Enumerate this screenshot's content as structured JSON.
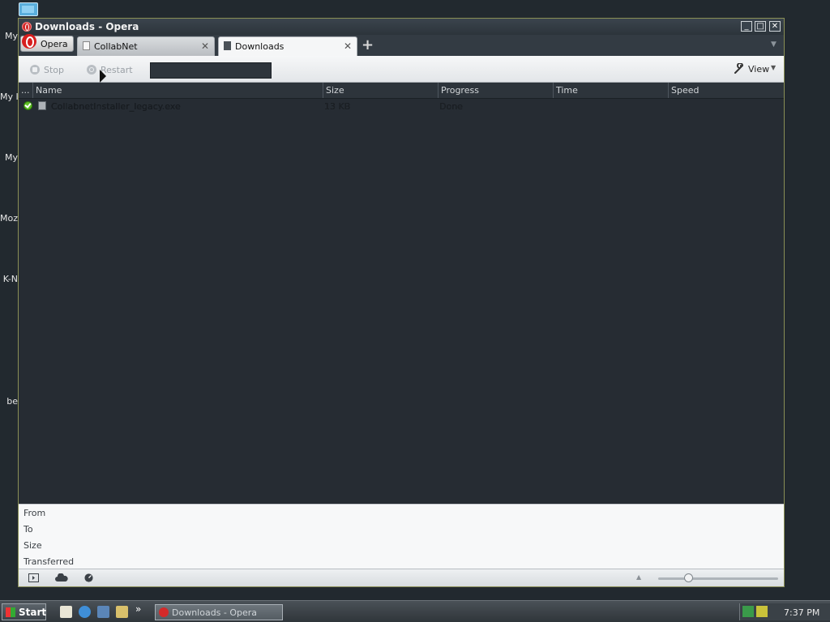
{
  "desktop": {
    "icon_labels": [
      "My",
      "My I",
      "My",
      "Moz",
      "K-N",
      "be"
    ]
  },
  "window": {
    "title": "Downloads - Opera",
    "controls": {
      "minimize": "_",
      "maximize": "□",
      "close": "✕"
    }
  },
  "tabs": {
    "opera_menu": "Opera",
    "items": [
      {
        "label": "CollabNet",
        "active": false,
        "close": "✕"
      },
      {
        "label": "Downloads",
        "active": true,
        "close": "✕"
      }
    ],
    "new_tab": "+",
    "tab_menu": "▼"
  },
  "toolbar": {
    "stop": "Stop",
    "restart": "Restart",
    "search_value": "",
    "view": "View",
    "view_arrow": "▼"
  },
  "table": {
    "columns": [
      "...",
      "Name",
      "Size",
      "Progress",
      "Time",
      "Speed"
    ],
    "rows": [
      {
        "status": "done",
        "name": "CollabnetInstaller_legacy.exe",
        "size": "13 KB",
        "progress": "Done",
        "time": "",
        "speed": ""
      }
    ]
  },
  "details": {
    "labels": [
      "From",
      "To",
      "Size",
      "Transferred"
    ]
  },
  "statusbar": {
    "up_arrow": "▲",
    "zoom_level": 0.25
  },
  "taskbar": {
    "start": "Start",
    "more": "»",
    "task_label": "Downloads - Opera",
    "clock": "7:37 PM"
  },
  "colors": {
    "accent_opera_red": "#d42a2a",
    "done_green": "#5fbf24",
    "list_bg": "#262c33"
  }
}
